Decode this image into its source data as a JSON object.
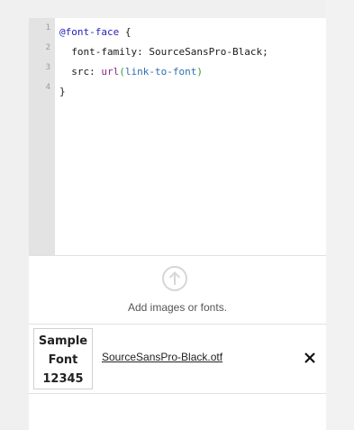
{
  "editor": {
    "line_numbers": [
      "1",
      "2",
      "3",
      "4"
    ],
    "lines": [
      {
        "atrule": "@font-face",
        "rest": " {"
      },
      {
        "text": "  font-family: SourceSansPro-Black;"
      },
      {
        "prop": "  src: ",
        "fn": "url",
        "open": "(",
        "arg": "link-to-font",
        "close": ")"
      },
      {
        "text": "}"
      }
    ]
  },
  "upload": {
    "icon": "upload-arrow-icon",
    "label": "Add images or fonts."
  },
  "file": {
    "thumbnail_lines": [
      "Sample",
      "Font",
      "12345"
    ],
    "name": "SourceSansPro-Black.otf",
    "remove_icon": "close-icon"
  },
  "colors": {
    "atrule": "#1f1fb8",
    "keyword": "#8a2b87",
    "paren": "#2f9e2f",
    "string": "#2d6fb0"
  }
}
